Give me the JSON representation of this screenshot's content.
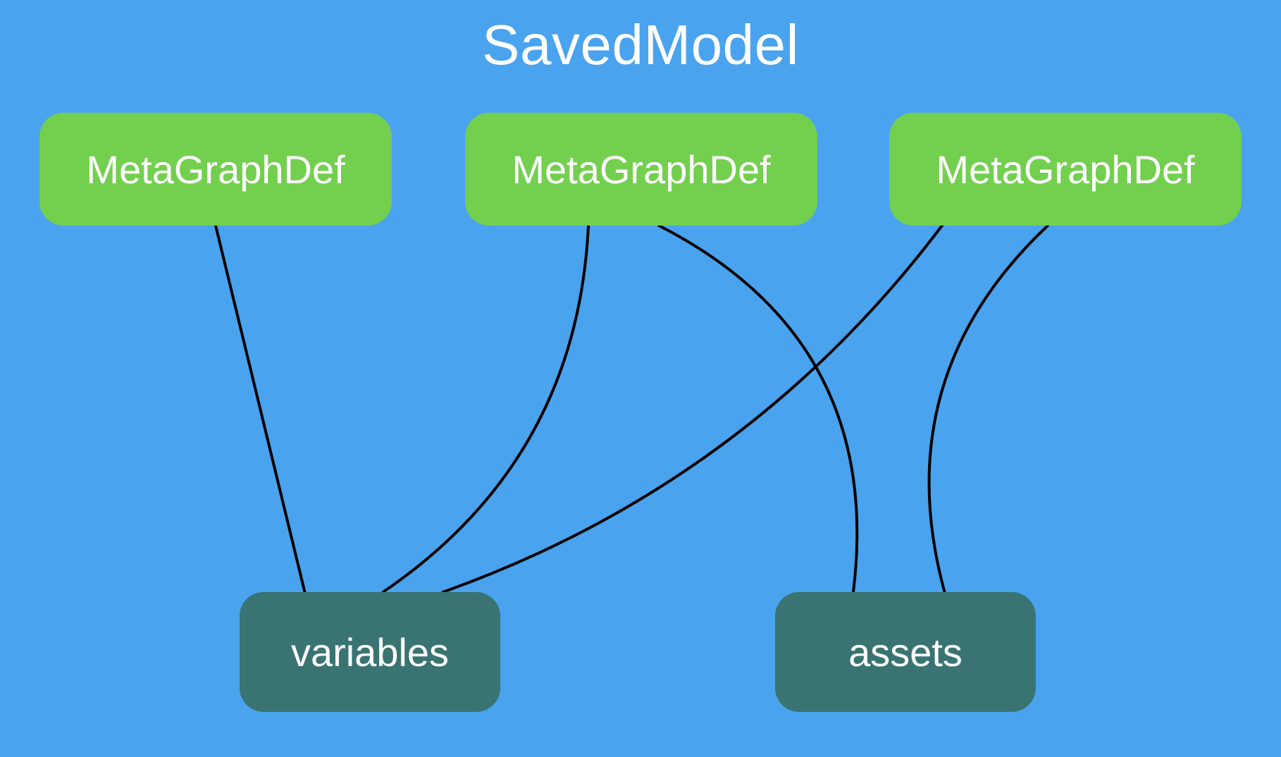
{
  "title": "SavedModel",
  "nodes": {
    "meta1": {
      "label": "MetaGraphDef"
    },
    "meta2": {
      "label": "MetaGraphDef"
    },
    "meta3": {
      "label": "MetaGraphDef"
    },
    "variables": {
      "label": "variables"
    },
    "assets": {
      "label": "assets"
    }
  },
  "layout": {
    "metaTop": 160,
    "metaW": 500,
    "metaH": 160,
    "meta1X": 56,
    "meta2X": 660,
    "meta3X": 1262,
    "bottomTop": 840,
    "bottomW": 370,
    "bottomH": 170,
    "varX": 340,
    "assetsX": 1100
  },
  "edges": [
    {
      "from": "meta1",
      "fromSide": "bottom",
      "fromT": 0.5,
      "to": "variables",
      "toSide": "top",
      "toT": 0.25,
      "bend": 0.0
    },
    {
      "from": "meta2",
      "fromSide": "bottom",
      "fromT": 0.35,
      "to": "variables",
      "toSide": "top",
      "toT": 0.55,
      "bend": -0.25
    },
    {
      "from": "meta2",
      "fromSide": "bottom",
      "fromT": 0.55,
      "to": "assets",
      "toSide": "top",
      "toT": 0.3,
      "bend": -0.35
    },
    {
      "from": "meta3",
      "fromSide": "bottom",
      "fromT": 0.15,
      "to": "variables",
      "toSide": "top",
      "toT": 0.78,
      "bend": -0.15
    },
    {
      "from": "meta3",
      "fromSide": "bottom",
      "fromT": 0.45,
      "to": "assets",
      "toSide": "top",
      "toT": 0.65,
      "bend": 0.3
    }
  ],
  "colors": {
    "background": "#4aa3ee",
    "metaFill": "#73d04f",
    "bottomFill": "#397472",
    "text": "#ffffff",
    "edge": "#000000"
  }
}
